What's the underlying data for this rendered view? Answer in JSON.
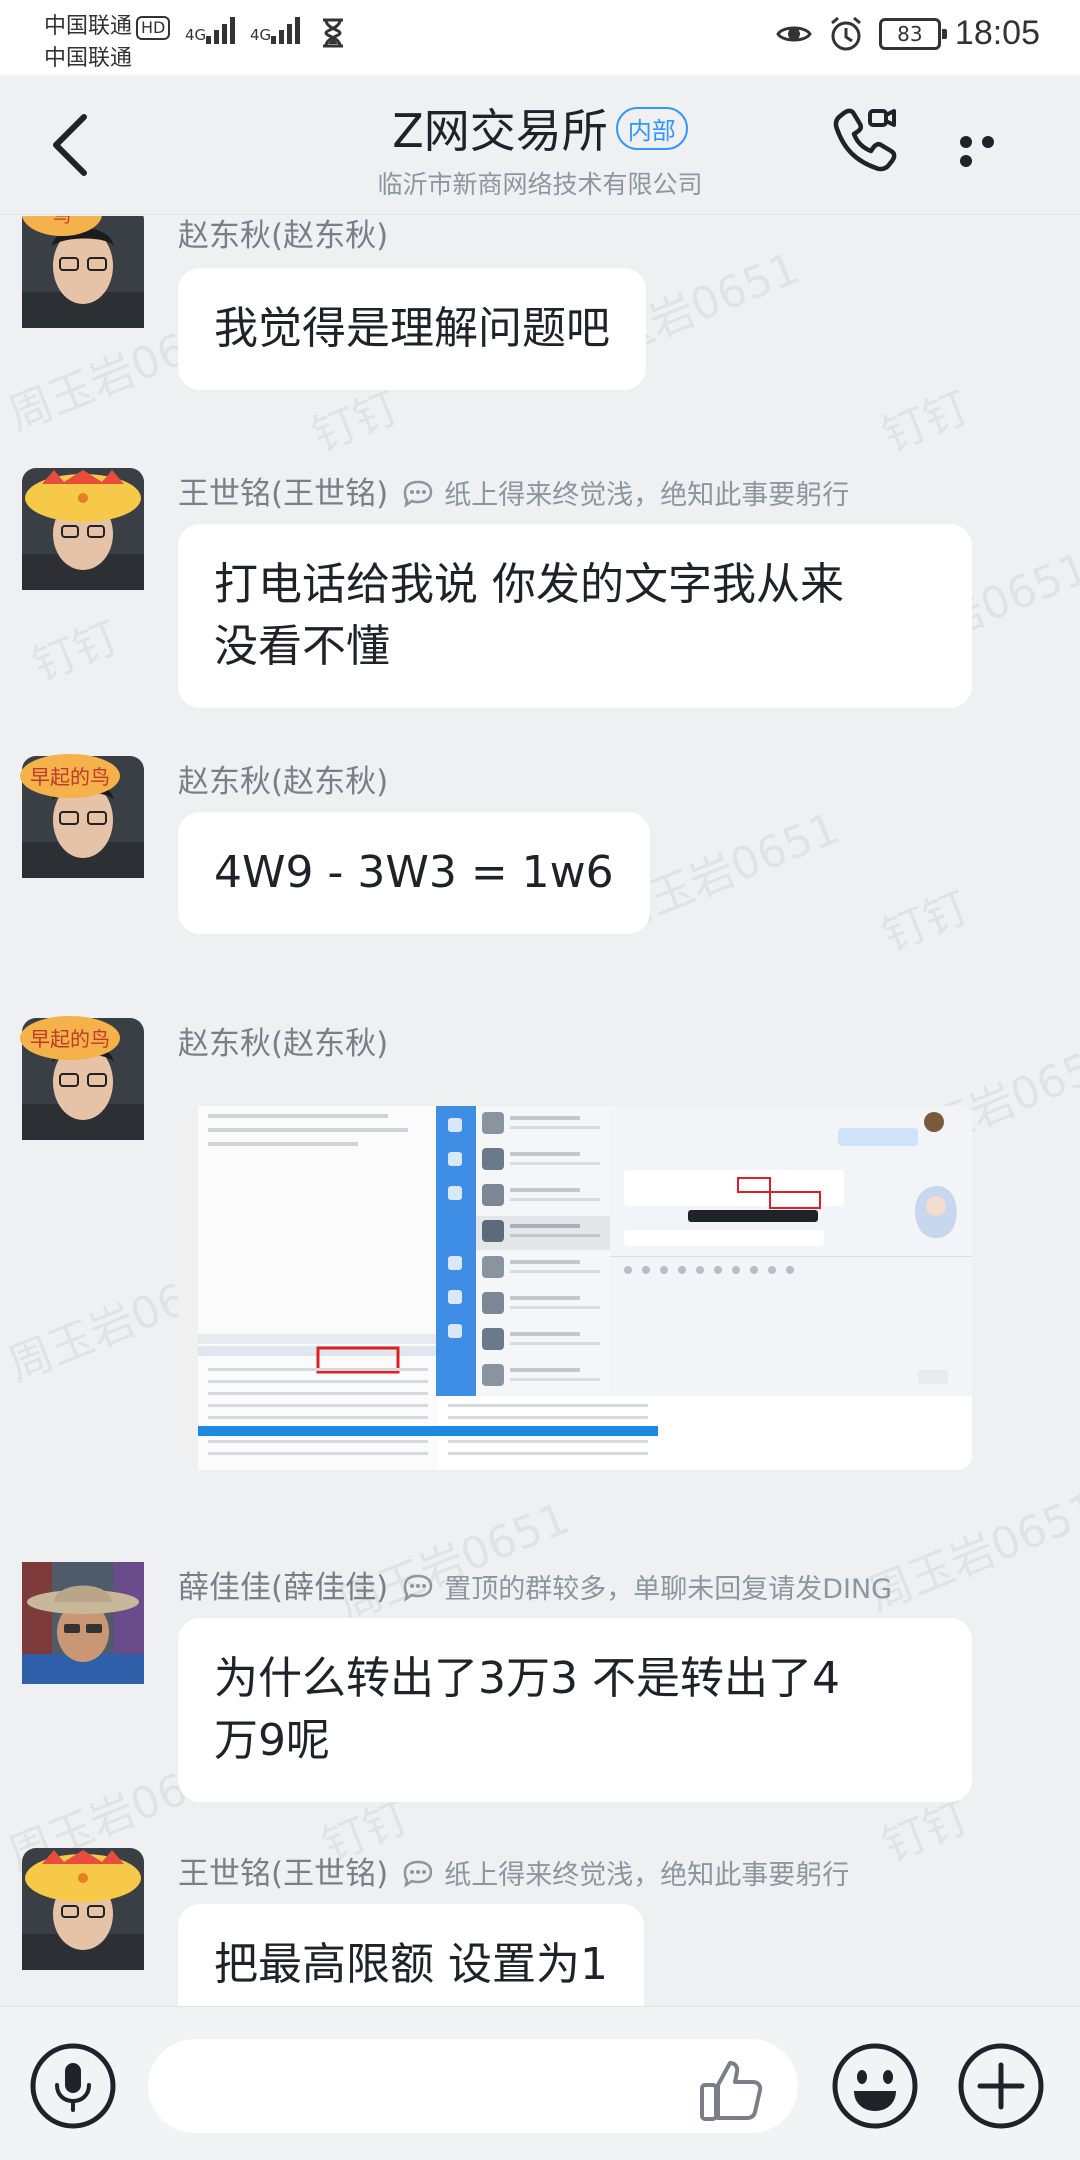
{
  "status_bar": {
    "carrier1": "中国联通",
    "carrier1_badge": "HD",
    "carrier2": "中国联通",
    "net1": "4G",
    "net2": "4G",
    "battery": "83",
    "time": "18:05"
  },
  "header": {
    "title": "Z网交易所",
    "tag": "内部",
    "subtitle": "临沂市新商网络技术有限公司"
  },
  "watermarks": [
    "周玉岩0651",
    "钉钉"
  ],
  "messages": [
    {
      "sender": "赵东秋(赵东秋)",
      "signature": "",
      "text": "我觉得是理解问题吧"
    },
    {
      "sender": "王世铭(王世铭)",
      "signature": "纸上得来终觉浅，绝知此事要躬行",
      "lines": [
        "打电话给我说 你发的文字我从来",
        "没看不懂"
      ]
    },
    {
      "sender": "赵东秋(赵东秋)",
      "signature": "",
      "text": "4W9 - 3W3 = 1w6"
    },
    {
      "sender": "赵东秋(赵东秋)",
      "signature": "",
      "image": "screenshot-image"
    },
    {
      "sender": "薛佳佳(薛佳佳)",
      "signature": "置顶的群较多，单聊未回复请发DING",
      "lines": [
        "为什么转出了3万3  不是转出了4",
        "万9呢"
      ]
    },
    {
      "sender": "王世铭(王世铭)",
      "signature": "纸上得来终觉浅，绝知此事要躬行",
      "text": "把最高限额 设置为1"
    }
  ],
  "input": {
    "placeholder": ""
  },
  "colors": {
    "accent": "#3296fa",
    "bubble": "#ffffff",
    "background": "#eef0f2",
    "text": "#1f2329",
    "muted": "#8f959e"
  },
  "icons": [
    "back-icon",
    "video-call-icon",
    "more-icon",
    "microphone-icon",
    "thumbs-up-icon",
    "emoji-icon",
    "plus-icon"
  ]
}
